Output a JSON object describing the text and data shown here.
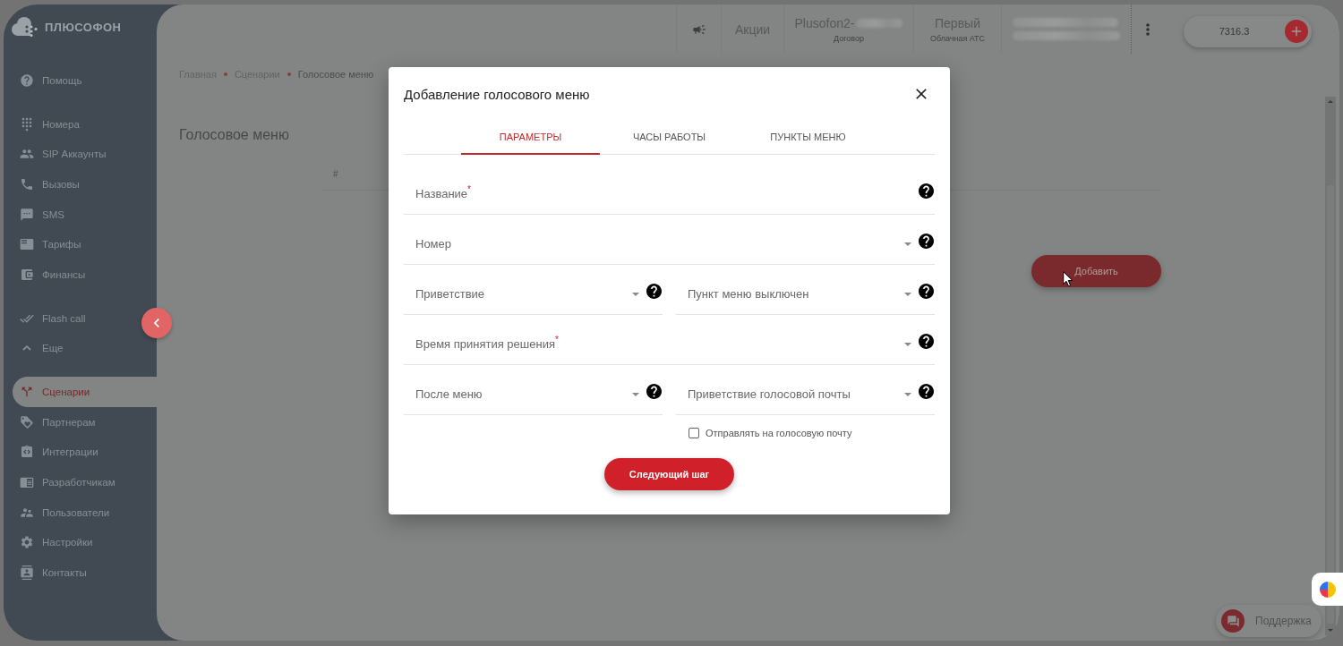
{
  "sidebar": {
    "logo": "ПЛЮСОФОН",
    "groups": [
      {
        "items": [
          {
            "label": "Помощь",
            "selected": false
          }
        ]
      },
      {
        "items": [
          {
            "label": "Номера",
            "selected": false
          },
          {
            "label": "SIP Аккаунты",
            "selected": false
          },
          {
            "label": "Вызовы",
            "selected": false
          },
          {
            "label": "SMS",
            "selected": false
          },
          {
            "label": "Тарифы",
            "selected": false
          },
          {
            "label": "Финансы",
            "selected": false
          }
        ]
      },
      {
        "items": [
          {
            "label": "Flash call",
            "selected": false
          }
        ]
      }
    ],
    "more": {
      "label": "Еще",
      "expanded": true,
      "items": [
        {
          "label": "Сценарии",
          "selected": true
        },
        {
          "label": "Партнерам",
          "selected": false
        },
        {
          "label": "Интеграции",
          "selected": false
        },
        {
          "label": "Разработчикам",
          "selected": false
        },
        {
          "label": "Пользователи",
          "selected": false
        },
        {
          "label": "Настройки",
          "selected": false
        },
        {
          "label": "Контакты",
          "selected": false
        }
      ]
    }
  },
  "header": {
    "promo": "Акции",
    "account": {
      "name": "Plusofon2-",
      "caption": "Договор"
    },
    "plan": {
      "name": "Первый",
      "caption": "Облачная АТС"
    },
    "balance": "7316.3"
  },
  "breadcrumbs": [
    "Главная",
    "Сценарии",
    "Голосовое меню"
  ],
  "page_title": "Голосовое меню",
  "table": {
    "columns": [
      "#"
    ]
  },
  "add_button": "Добавить",
  "support": "Поддержка",
  "dialog": {
    "title": "Добавление голосового меню",
    "tabs": [
      {
        "label": "ПАРАМЕТРЫ",
        "selected": true
      },
      {
        "label": "ЧАСЫ РАБОТЫ",
        "selected": false
      },
      {
        "label": "ПУНКТЫ МЕНЮ",
        "selected": false
      }
    ],
    "rows": [
      {
        "fields": [
          {
            "kind": "text",
            "label": "Название$^{*}$"
          }
        ]
      },
      {
        "fields": [
          {
            "kind": "select",
            "label": "Номер"
          }
        ]
      },
      {
        "fields": [
          {
            "kind": "select",
            "label": "Приветствие"
          },
          {
            "kind": "select",
            "label": "Пункт меню выключен"
          }
        ]
      },
      {
        "fields": [
          {
            "kind": "select",
            "label": "Время принятия решения$^{*}$"
          }
        ]
      },
      {
        "fields": [
          {
            "kind": "select",
            "label": "После меню"
          },
          {
            "kind": "select",
            "label": "Приветствие голосовой почты"
          }
        ]
      }
    ],
    "checkbox": {
      "label": "Отправлять на голосовую почту",
      "checked": false
    },
    "submit": "Следующий шаг"
  }
}
